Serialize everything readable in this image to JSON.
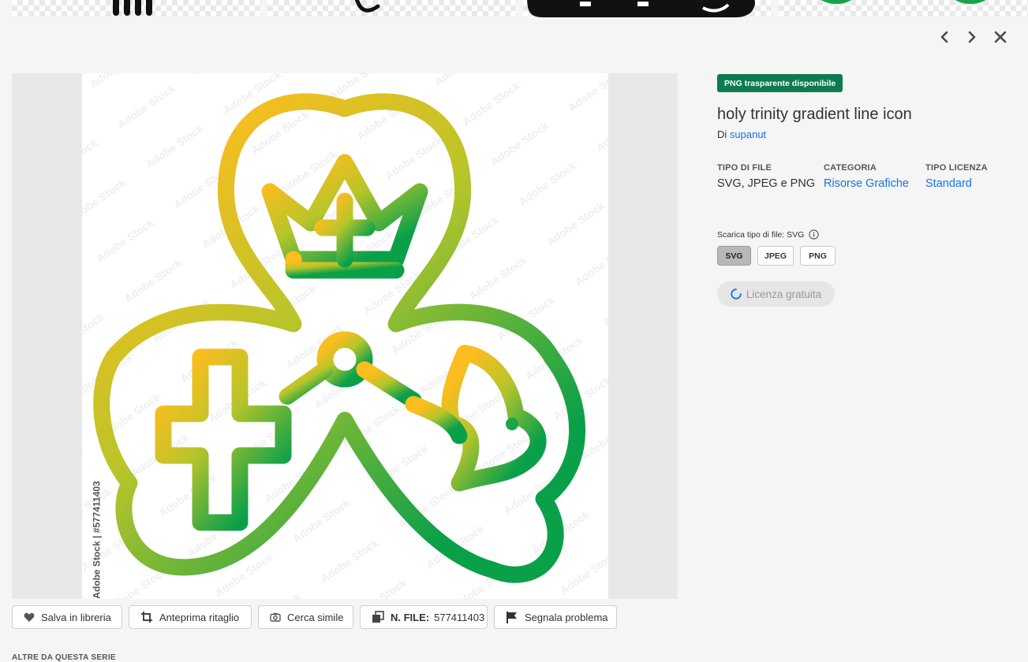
{
  "asset": {
    "badge": "PNG trasparente disponibile",
    "title": "holy trinity gradient line icon",
    "author_prefix": "Di",
    "author": "supanut",
    "credit": "Adobe Stock | #577411403",
    "watermark": "Adobe Stock"
  },
  "meta": {
    "file_type_label": "TIPO DI FILE",
    "file_type_value": "SVG, JPEG e PNG",
    "category_label": "CATEGORIA",
    "category_value": "Risorse Grafiche",
    "license_type_label": "TIPO LICENZA",
    "license_type_value": "Standard"
  },
  "download": {
    "label": "Scarica tipo di file: SVG",
    "formats": [
      "SVG",
      "JPEG",
      "PNG"
    ],
    "selected": "SVG",
    "license_button": "Licenza gratuita"
  },
  "actions": {
    "save": "Salva in libreria",
    "crop": "Anteprima ritaglio",
    "similar": "Cerca simile",
    "file_no_label": "N. FILE:",
    "file_no_value": "577411403",
    "report": "Segnala problema"
  },
  "series_title": "ALTRE DA QUESTA SERIE",
  "colors": {
    "badge_bg": "#0d7b4f",
    "link": "#1473e6",
    "icon_gradient_start": "#fbbd1f",
    "icon_gradient_end": "#0aa04a"
  },
  "icons": [
    "chevron-left-icon",
    "chevron-right-icon",
    "close-icon",
    "heart-icon",
    "crop-icon",
    "camera-icon",
    "file-number-icon",
    "flag-icon",
    "info-icon",
    "spinner-icon"
  ]
}
